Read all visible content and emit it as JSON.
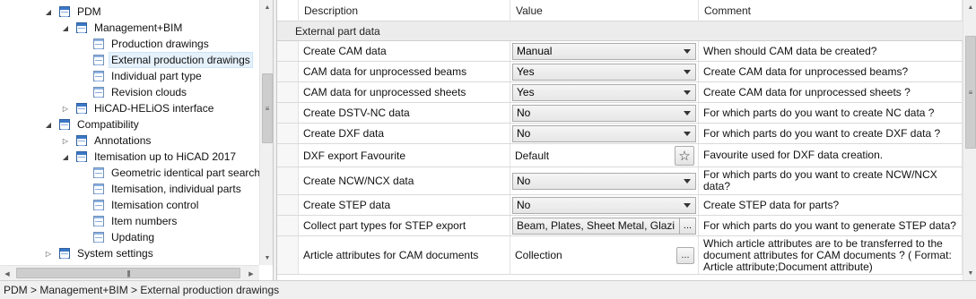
{
  "tree": {
    "items": [
      {
        "label": "PDM",
        "level": 0,
        "expander": "open",
        "icon": "table-icon"
      },
      {
        "label": "Management+BIM",
        "level": 1,
        "expander": "open",
        "icon": "table-icon"
      },
      {
        "label": "Production drawings",
        "level": 2,
        "expander": "none",
        "icon": "grid-icon"
      },
      {
        "label": "External production drawings",
        "level": 2,
        "expander": "none",
        "icon": "grid-icon",
        "selected": true
      },
      {
        "label": "Individual part type",
        "level": 2,
        "expander": "none",
        "icon": "grid-icon"
      },
      {
        "label": "Revision clouds",
        "level": 2,
        "expander": "none",
        "icon": "grid-icon"
      },
      {
        "label": "HiCAD-HELiOS interface",
        "level": 1,
        "expander": "closed",
        "icon": "table-icon"
      },
      {
        "label": "Compatibility",
        "level": 0,
        "expander": "open",
        "icon": "table-icon"
      },
      {
        "label": "Annotations",
        "level": 1,
        "expander": "closed",
        "icon": "table-icon"
      },
      {
        "label": "Itemisation up to HiCAD 2017",
        "level": 1,
        "expander": "open",
        "icon": "table-icon"
      },
      {
        "label": "Geometric identical part search",
        "level": 2,
        "expander": "none",
        "icon": "grid-icon"
      },
      {
        "label": "Itemisation, individual parts",
        "level": 2,
        "expander": "none",
        "icon": "grid-icon"
      },
      {
        "label": "Itemisation control",
        "level": 2,
        "expander": "none",
        "icon": "grid-icon"
      },
      {
        "label": "Item numbers",
        "level": 2,
        "expander": "none",
        "icon": "grid-icon"
      },
      {
        "label": "Updating",
        "level": 2,
        "expander": "none",
        "icon": "grid-icon"
      },
      {
        "label": "System settings",
        "level": 0,
        "expander": "closed",
        "icon": "table-icon"
      }
    ]
  },
  "grid": {
    "headers": {
      "description": "Description",
      "value": "Value",
      "comment": "Comment"
    },
    "group": "External part data",
    "rows": [
      {
        "description": "Create CAM data",
        "type": "combo",
        "value": "Manual",
        "comment": "When should CAM data be created?"
      },
      {
        "description": "CAM data for unprocessed beams",
        "type": "combo",
        "value": "Yes",
        "comment": "Create CAM data for unprocessed beams?"
      },
      {
        "description": "CAM data for unprocessed sheets",
        "type": "combo",
        "value": "Yes",
        "comment": "Create CAM data for unprocessed sheets ?"
      },
      {
        "description": "Create DSTV-NC data",
        "type": "combo",
        "value": "No",
        "comment": "For which parts do you want to create NC data ?"
      },
      {
        "description": "Create DXF data",
        "type": "combo",
        "value": "No",
        "comment": "For which parts do you want to create DXF data ?"
      },
      {
        "description": "DXF export Favourite",
        "type": "star",
        "value": "Default",
        "comment": "Favourite used for DXF data creation."
      },
      {
        "description": "Create NCW/NCX data",
        "type": "combo",
        "value": "No",
        "comment": "For which parts do you want to create NCW/NCX data?"
      },
      {
        "description": "Create STEP data",
        "type": "combo",
        "value": "No",
        "comment": "Create STEP data for parts?"
      },
      {
        "description": "Collect part types for STEP export",
        "type": "multi",
        "value": "Beam, Plates, Sheet Metal, Glazi",
        "button": "...",
        "comment": "For which parts do you want to generate STEP data?"
      },
      {
        "description": "Article attributes for CAM documents",
        "type": "ellipsis",
        "value": "Collection",
        "button": "...",
        "comment": "Which article attributes are to be transferred to the document attributes for CAM documents ? ( Format: Article attribute;Document attribute)"
      }
    ]
  },
  "status": {
    "breadcrumb": "PDM > Management+BIM > External production drawings"
  }
}
